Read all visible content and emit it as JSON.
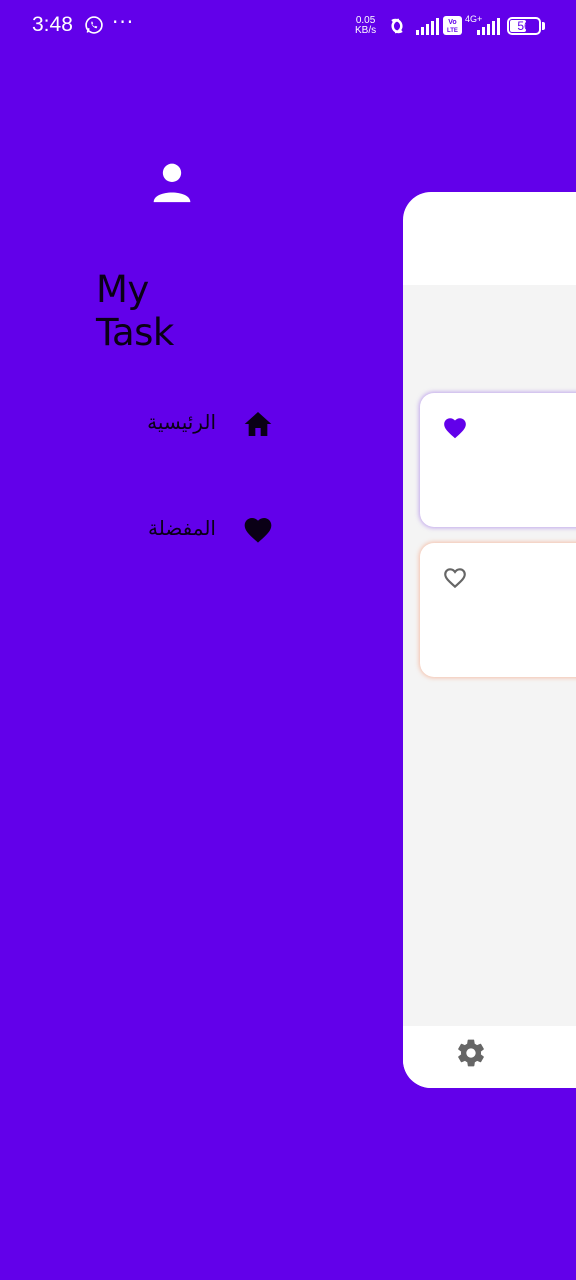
{
  "status_bar": {
    "time": "3:48",
    "dots": "···",
    "net_speed_value": "0.05",
    "net_speed_unit": "KB/s",
    "network_label": "4G+",
    "volte_label": "Vo LTE",
    "battery": "56"
  },
  "drawer": {
    "avatar_icon": "person-icon",
    "title": "My Task",
    "items": [
      {
        "label": "الرئيسية",
        "icon": "home-icon"
      },
      {
        "label": "المفضلة",
        "icon": "heart-icon"
      }
    ]
  },
  "panel": {
    "cards": [
      {
        "favorite": true,
        "accent": "#6200EA"
      },
      {
        "favorite": false,
        "accent": "#F59A6E"
      }
    ],
    "bottom_nav": {
      "icon": "settings-icon"
    }
  },
  "colors": {
    "background": "#6200EA",
    "panel": "#FFFFFF",
    "panel_body": "#F4F4F4",
    "text_dark": "#0A0016"
  }
}
